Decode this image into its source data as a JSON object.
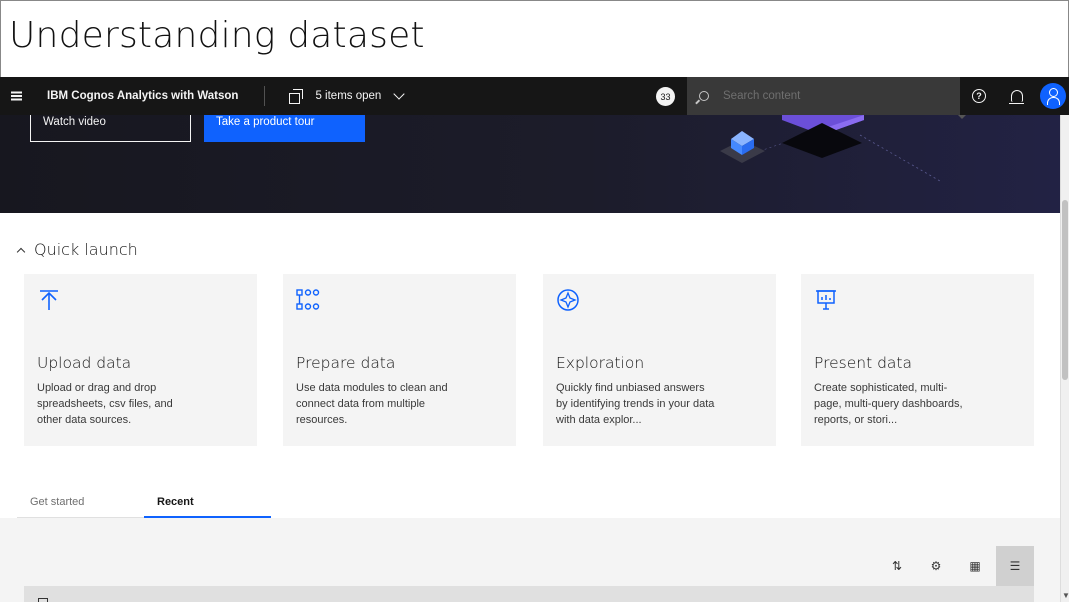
{
  "slide": {
    "title": "Understanding dataset"
  },
  "topbar": {
    "brand": "IBM Cognos Analytics with Watson",
    "items_open": "5 items open",
    "badge": "33",
    "search_placeholder": "Search content"
  },
  "hero": {
    "watch_video": "Watch video",
    "product_tour": "Take a product tour"
  },
  "quick_launch": {
    "title": "Quick launch",
    "tiles": [
      {
        "title": "Upload data",
        "desc": "Upload or drag and drop spreadsheets, csv files, and other data sources.",
        "icon": "upload-icon"
      },
      {
        "title": "Prepare data",
        "desc": "Use data modules to clean and connect data from multiple resources.",
        "icon": "data-module-icon"
      },
      {
        "title": "Exploration",
        "desc": "Quickly find unbiased answers by identifying trends in your data with data explor...",
        "icon": "exploration-icon"
      },
      {
        "title": "Present data",
        "desc": "Create sophisticated, multi-page, multi-query dashboards, reports, or stori...",
        "icon": "presentation-icon"
      }
    ]
  },
  "tabs": {
    "get_started": "Get started",
    "recent": "Recent"
  },
  "colors": {
    "accent": "#0f62fe",
    "topbar": "#161616",
    "tile": "#f4f4f4"
  }
}
